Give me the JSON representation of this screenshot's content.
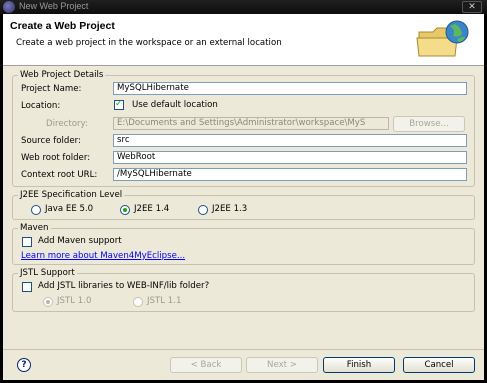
{
  "window": {
    "title": "New Web Project",
    "close_glyph": "✕"
  },
  "header": {
    "title": "Create a Web Project",
    "description": "Create a web project in the workspace or an external location",
    "banner_icon": "folder-globe-icon"
  },
  "details": {
    "legend": "Web Project Details",
    "project_name_label": "Project Name:",
    "project_name_value": "MySQLHibernate",
    "location_label": "Location:",
    "use_default_label": "Use default location",
    "use_default_checked": true,
    "directory_label": "Directory:",
    "directory_value": "E:\\Documents and Settings\\Administrator\\workspace\\MyS",
    "browse_label": "Browse...",
    "source_folder_label": "Source folder:",
    "source_folder_value": "src",
    "web_root_label": "Web root folder:",
    "web_root_value": "WebRoot",
    "context_root_label": "Context root URL:",
    "context_root_value": "/MySQLHibernate"
  },
  "j2ee": {
    "legend": "J2EE Specification Level",
    "options": [
      "Java EE 5.0",
      "J2EE 1.4",
      "J2EE 1.3"
    ],
    "selected": "J2EE 1.4"
  },
  "maven": {
    "legend": "Maven",
    "add_label": "Add Maven support",
    "add_checked": false,
    "learn_more": "Learn more about Maven4MyEclipse..."
  },
  "jstl": {
    "legend": "JSTL Support",
    "add_label": "Add JSTL libraries to WEB-INF/lib folder?",
    "add_checked": false,
    "options": [
      "JSTL 1.0",
      "JSTL 1.1"
    ],
    "selected": "JSTL 1.0"
  },
  "footer": {
    "help_glyph": "?",
    "back_label": "< Back",
    "next_label": "Next >",
    "finish_label": "Finish",
    "cancel_label": "Cancel"
  },
  "colors": {
    "accent_check": "#21a121",
    "link": "#0000ff",
    "button_border": "#003c74"
  }
}
